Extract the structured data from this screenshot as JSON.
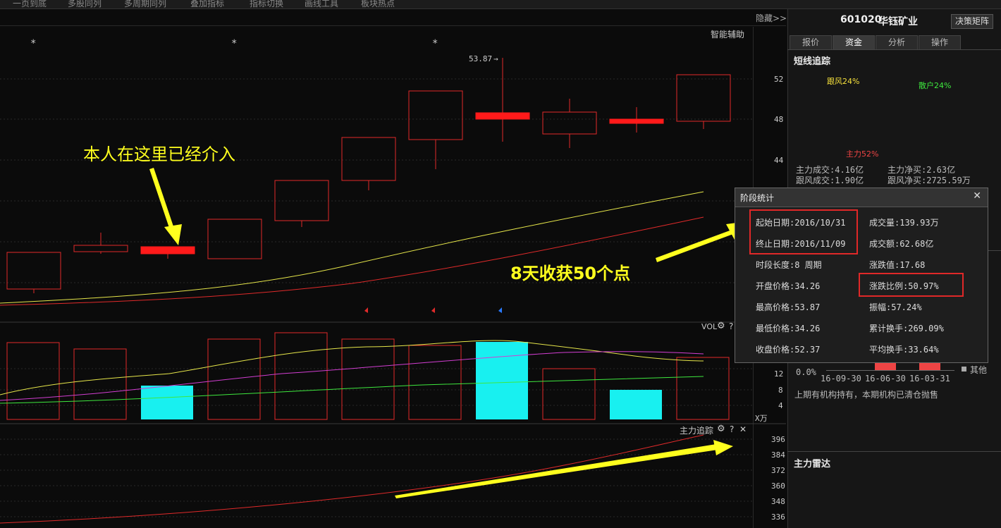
{
  "top_menu": [
    "一页到底",
    "多股同列",
    "多周期同列",
    "叠加指标",
    "指标切换",
    "画线工具",
    "板块热点"
  ],
  "header": {
    "hide_label": "隐藏>>",
    "smart_assist_label": "智能辅助",
    "stock_code": "601020",
    "stock_name": "华钰矿业",
    "decision_button": "决策矩阵"
  },
  "tabs": [
    {
      "label": "报价",
      "active": false
    },
    {
      "label": "资金",
      "active": true
    },
    {
      "label": "分析",
      "active": false
    },
    {
      "label": "操作",
      "active": false
    }
  ],
  "main_chart": {
    "peak_label": "53.87",
    "y_ticks": [
      "52",
      "48",
      "44"
    ],
    "annotation_text": "本人在这里已经介入",
    "gain_text": "8天收获50个点"
  },
  "volume_panel": {
    "label": "VOL",
    "y_ticks": [
      "12",
      "8",
      "4"
    ],
    "unit": "X万"
  },
  "indicator_panel": {
    "label": "主力追踪",
    "y_ticks": [
      "396",
      "384",
      "372",
      "360",
      "348",
      "336"
    ]
  },
  "short_track": {
    "title": "短线追踪",
    "donut_labels": {
      "follow": "跟风24%",
      "retail": "散户24%",
      "main": "主力52%"
    },
    "colors": {
      "follow": "#f5e03c",
      "retail": "#3ee83e",
      "main": "#ee4444"
    },
    "stats_row1": [
      "主力成交:4.16亿",
      "主力净买:2.63亿"
    ],
    "stats_row2": [
      "跟风成交:1.90亿",
      "跟风净买:2725.59万"
    ]
  },
  "holdings": {
    "pct_label": "0.0%",
    "dates": [
      "16-09-30",
      "16-06-30",
      "16-03-31"
    ],
    "legend_other": "其他",
    "note": "上期有机构持有，本期机构已清仓抛售"
  },
  "radar": {
    "title": "主力雷达"
  },
  "dialog": {
    "title": "阶段统计",
    "close_label": "✕",
    "left": [
      "起始日期:2016/10/31",
      "终止日期:2016/11/09",
      "时段长度:8 周期",
      "开盘价格:34.26",
      "最高价格:53.87",
      "最低价格:34.26",
      "收盘价格:52.37"
    ],
    "right": [
      "成交量:139.93万",
      "成交额:62.68亿",
      "涨跌值:17.68",
      "涨跌比例:50.97%",
      "振幅:57.24%",
      "累计换手:269.09%",
      "平均换手:33.64%"
    ]
  }
}
